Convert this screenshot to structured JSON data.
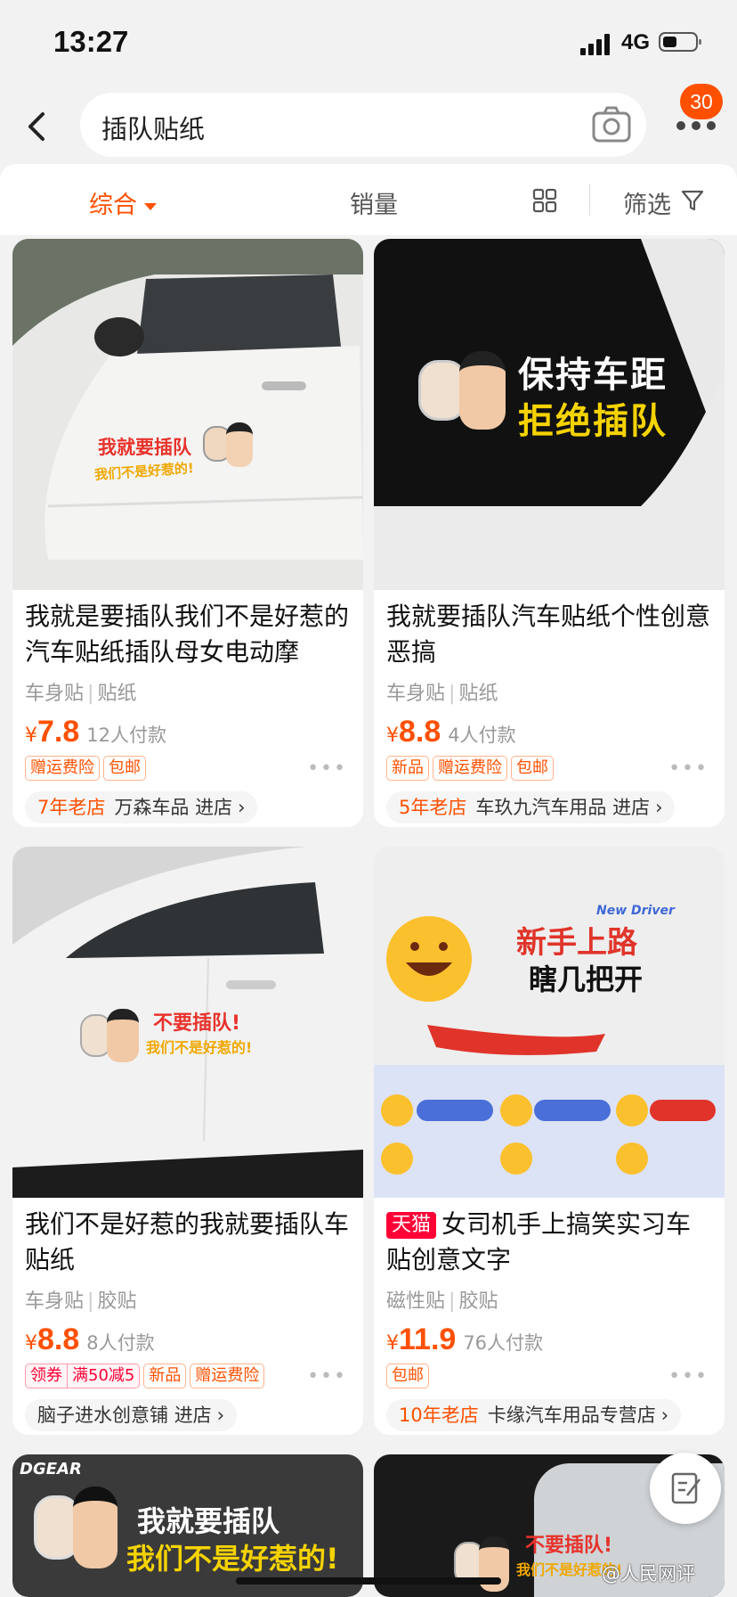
{
  "status": {
    "time": "13:27",
    "network": "4G"
  },
  "search": {
    "query": "插队贴纸",
    "cart_badge": "30"
  },
  "sort": {
    "comprehensive": "综合",
    "sales": "销量",
    "filter": "筛选"
  },
  "products": [
    {
      "title": "我就是要插队我们不是好惹的汽车贴纸插队母女电动摩",
      "props": [
        "车身贴",
        "贴纸"
      ],
      "currency": "¥",
      "price": "7.8",
      "sold": "12人付款",
      "tags": [
        "赠运费险",
        "包邮"
      ],
      "shop_age": "7年老店",
      "shop_name": "万森车品",
      "shop_enter": "进店",
      "image_text": [
        "我就要插队",
        "我们不是好惹的!"
      ]
    },
    {
      "title": "我就要插队汽车贴纸个性创意恶搞",
      "props": [
        "车身贴",
        "贴纸"
      ],
      "currency": "¥",
      "price": "8.8",
      "sold": "4人付款",
      "tags": [
        "新品",
        "赠运费险",
        "包邮"
      ],
      "shop_age": "5年老店",
      "shop_name": "车玖九汽车用品",
      "shop_enter": "进店",
      "image_text": [
        "保持车距",
        "拒绝插队"
      ]
    },
    {
      "title": "我们不是好惹的我就要插队车贴纸",
      "props": [
        "车身贴",
        "胶贴"
      ],
      "currency": "¥",
      "price": "8.8",
      "sold": "8人付款",
      "coupon": [
        "领券",
        "满50减5"
      ],
      "tags": [
        "新品",
        "赠运费险"
      ],
      "shop_name": "脑子进水创意铺",
      "shop_enter": "进店",
      "image_text": [
        "不要插队!",
        "我们不是好惹的!"
      ]
    },
    {
      "title": "女司机手上搞笑实习车贴创意文字",
      "tmall": "天猫",
      "props": [
        "磁性贴",
        "胶贴"
      ],
      "currency": "¥",
      "price": "11.9",
      "sold": "76人付款",
      "tags": [
        "包邮"
      ],
      "shop_age": "10年老店",
      "shop_name": "卡缘汽车用品专营店",
      "image_text": [
        "新手上路",
        "瞎几把开",
        "New Driver"
      ]
    },
    {
      "image_text": [
        "DGEAR",
        "我就要插队",
        "我们不是好惹的!"
      ]
    },
    {
      "image_text": [
        "不要插队!",
        "我们不是好惹的!"
      ]
    }
  ],
  "watermark": "@人民网评"
}
